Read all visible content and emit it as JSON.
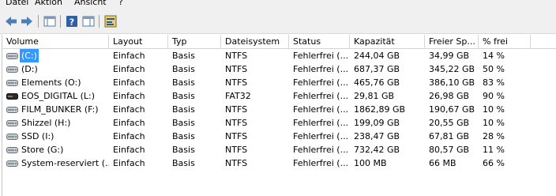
{
  "menu": {
    "file": "Datei",
    "action": "Aktion",
    "view": "Ansicht",
    "help": "?"
  },
  "toolbar": {
    "back_icon": "arrow-left-icon",
    "forward_icon": "arrow-right-icon",
    "show_hide_tree_icon": "console-tree-icon",
    "help_icon": "help-icon",
    "action_pane_icon": "action-pane-icon",
    "properties_icon": "properties-icon"
  },
  "table": {
    "columns": [
      "Volume",
      "Layout",
      "Typ",
      "Dateisystem",
      "Status",
      "Kapazität",
      "Freier Sp...",
      "% frei"
    ],
    "rows": [
      {
        "volume": "(C:)",
        "layout": "Einfach",
        "typ": "Basis",
        "fs": "NTFS",
        "status": "Fehlerfrei (...",
        "capacity": "244,04 GB",
        "free": "34,99 GB",
        "pct": "14 %",
        "drive_icon": "disk-drive-icon",
        "selected": true
      },
      {
        "volume": "(D:)",
        "layout": "Einfach",
        "typ": "Basis",
        "fs": "NTFS",
        "status": "Fehlerfrei (...",
        "capacity": "687,37 GB",
        "free": "345,22 GB",
        "pct": "50 %",
        "drive_icon": "disk-drive-icon"
      },
      {
        "volume": "Elements (O:)",
        "layout": "Einfach",
        "typ": "Basis",
        "fs": "NTFS",
        "status": "Fehlerfrei (...",
        "capacity": "465,76 GB",
        "free": "386,10 GB",
        "pct": "83 %",
        "drive_icon": "disk-drive-icon"
      },
      {
        "volume": "EOS_DIGITAL (L:)",
        "layout": "Einfach",
        "typ": "Basis",
        "fs": "FAT32",
        "status": "Fehlerfrei (...",
        "capacity": "29,81 GB",
        "free": "26,98 GB",
        "pct": "90 %",
        "drive_icon": "removable-drive-icon"
      },
      {
        "volume": "FILM_BUNKER (F:)",
        "layout": "Einfach",
        "typ": "Basis",
        "fs": "NTFS",
        "status": "Fehlerfrei (...",
        "capacity": "1862,89 GB",
        "free": "190,67 GB",
        "pct": "10 %",
        "drive_icon": "disk-drive-icon"
      },
      {
        "volume": "Shizzel (H:)",
        "layout": "Einfach",
        "typ": "Basis",
        "fs": "NTFS",
        "status": "Fehlerfrei (...",
        "capacity": "199,09 GB",
        "free": "20,55 GB",
        "pct": "10 %",
        "drive_icon": "disk-drive-icon"
      },
      {
        "volume": "SSD (I:)",
        "layout": "Einfach",
        "typ": "Basis",
        "fs": "NTFS",
        "status": "Fehlerfrei (...",
        "capacity": "238,47 GB",
        "free": "67,81 GB",
        "pct": "28 %",
        "drive_icon": "disk-drive-icon"
      },
      {
        "volume": "Store (G:)",
        "layout": "Einfach",
        "typ": "Basis",
        "fs": "NTFS",
        "status": "Fehlerfrei (...",
        "capacity": "732,42 GB",
        "free": "80,57 GB",
        "pct": "11 %",
        "drive_icon": "disk-drive-icon"
      },
      {
        "volume": "System-reserviert (...",
        "layout": "Einfach",
        "typ": "Basis",
        "fs": "NTFS",
        "status": "Fehlerfrei (...",
        "capacity": "100 MB",
        "free": "66 MB",
        "pct": "66 %",
        "drive_icon": "disk-drive-icon"
      }
    ]
  },
  "colors": {
    "selection": "#3399ff",
    "chrome": "#f0f0f0",
    "grid_line": "#d5d5d5"
  }
}
